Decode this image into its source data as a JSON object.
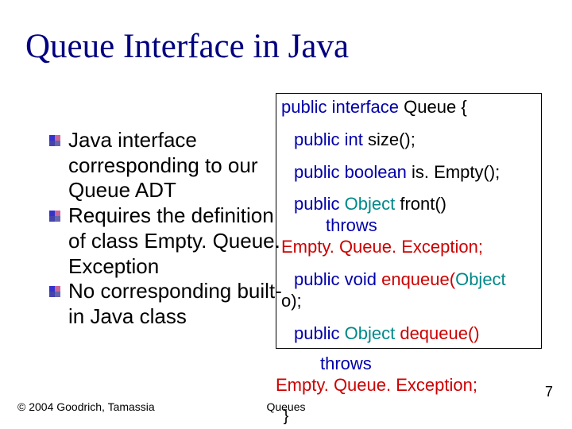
{
  "title": "Queue Interface in Java",
  "bullets": {
    "b1": "Java interface corresponding to our Queue ADT",
    "b2": "Requires the definition of class Empty. Queue. Exception",
    "b3": "No corresponding built-in Java class"
  },
  "code": {
    "kw_public": "public",
    "kw_interface": "interface",
    "kw_int": "int",
    "kw_boolean": "boolean",
    "kw_void": "void",
    "kw_throws": "throws",
    "type_object": "Object",
    "cls_queue": "Queue",
    "obr": "{",
    "fn_size": "size();",
    "fn_isempty": "is. Empty();",
    "fn_front": "front()",
    "exc": "Empty. Queue. Exception;",
    "fn_enqueue_a": "enqueue(",
    "fn_enqueue_b": "o);",
    "fn_dequeue": "dequeue()",
    "cbr": "}"
  },
  "footer": {
    "copyright": "© 2004 Goodrich, Tamassia",
    "center": "Queues",
    "page": "7"
  }
}
